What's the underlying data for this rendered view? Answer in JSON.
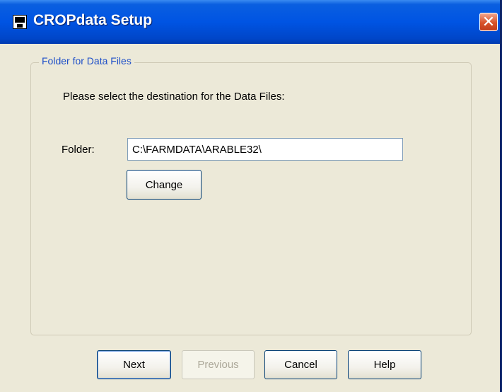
{
  "window": {
    "title": "CROPdata Setup",
    "close_label": "✕"
  },
  "group": {
    "legend": "Folder for Data Files",
    "instruction": "Please select the destination for the Data Files:"
  },
  "folder": {
    "label": "Folder:",
    "value": "C:\\FARMDATA\\ARABLE32\\"
  },
  "buttons": {
    "change": "Change",
    "next": "Next",
    "previous": "Previous",
    "cancel": "Cancel",
    "help": "Help"
  },
  "colors": {
    "titlebar": "#0054e3",
    "legend_text": "#1e4fc8",
    "close_button": "#d8522a"
  }
}
